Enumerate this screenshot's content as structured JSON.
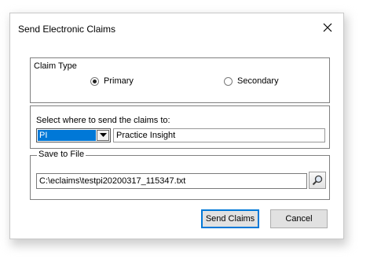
{
  "window": {
    "title": "Send Electronic Claims",
    "close_icon": "close-icon"
  },
  "claim_type": {
    "label": "Claim Type",
    "options": [
      {
        "label": "Primary",
        "selected": true
      },
      {
        "label": "Secondary",
        "selected": false
      }
    ]
  },
  "destination": {
    "label": "Select where to send the claims to:",
    "selected_code": "PI",
    "selected_name": "Practice Insight",
    "dropdown_icon": "chevron-down-icon"
  },
  "save_to_file": {
    "label": "Save to File",
    "path": "C:\\eclaims\\testpi20200317_115347.txt",
    "browse_icon": "magnifier-icon"
  },
  "buttons": {
    "send": "Send Claims",
    "cancel": "Cancel"
  },
  "colors": {
    "selection": "#0078d7",
    "default_button_border": "#0078d7"
  }
}
